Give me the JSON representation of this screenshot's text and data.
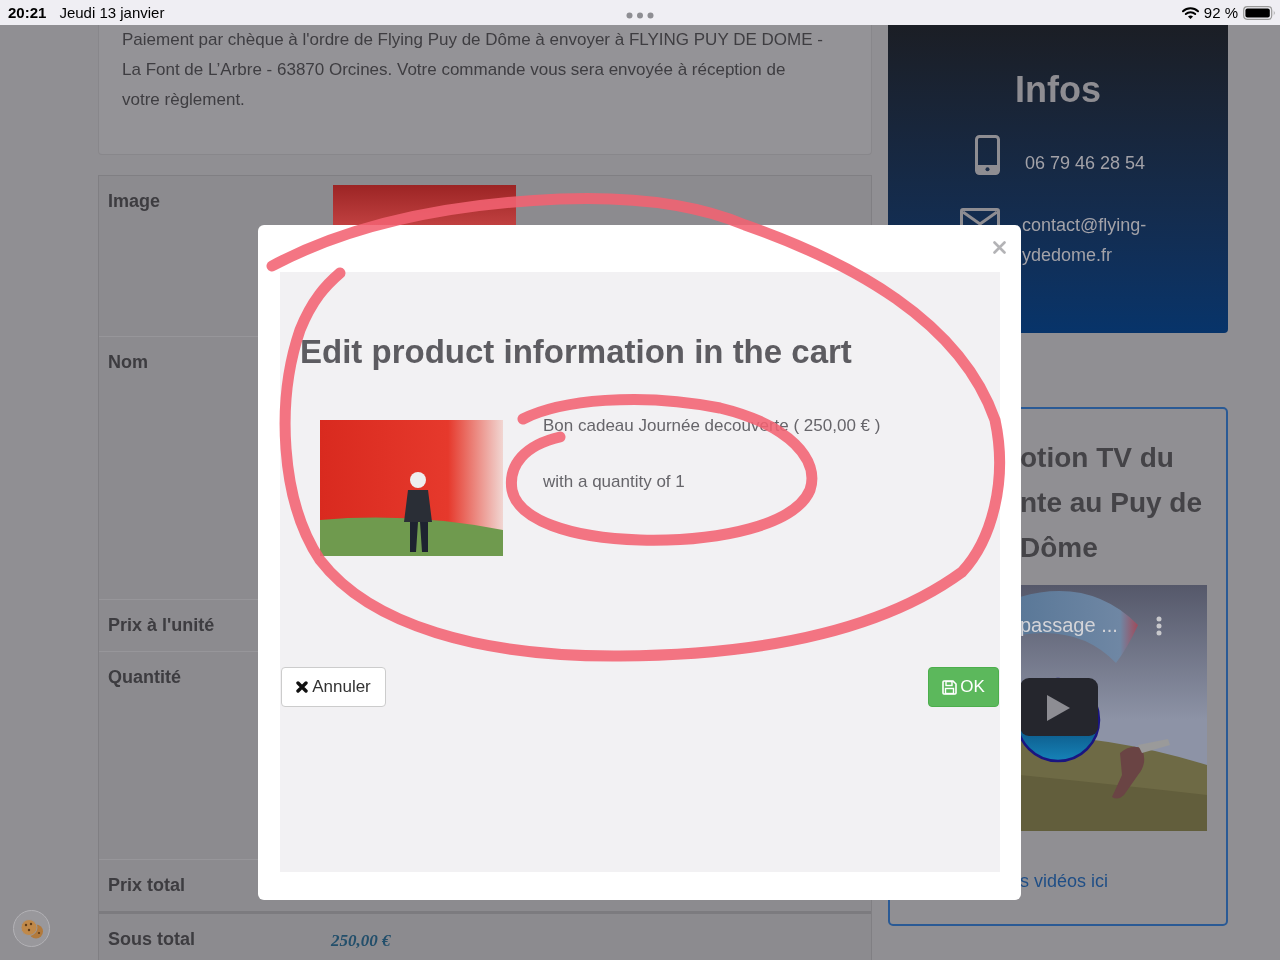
{
  "status_bar": {
    "time": "20:21",
    "date": "Jeudi 13 janvier",
    "battery": "92 %"
  },
  "payment_note": {
    "lines": [
      "Paiement par chèque à l'ordre de Flying Puy de Dôme à envoyer à FLYING PUY DE DOME -",
      "La Font de L’Arbre - 63870 Orcines. Votre commande vous sera envoyée à réception de",
      "votre règlement."
    ]
  },
  "cart_table": {
    "rows": [
      {
        "label": "Image",
        "kind": "image"
      },
      {
        "label": "Nom",
        "kind": "text"
      },
      {
        "label": "Prix à l'unité",
        "kind": "text"
      },
      {
        "label": "Quantité",
        "kind": "text"
      },
      {
        "label": "Prix total",
        "kind": "text"
      },
      {
        "label": "Sous total",
        "kind": "total",
        "value": "250,00 €"
      }
    ]
  },
  "infos": {
    "title": "Infos",
    "phone": "06 79 46 28 54",
    "email_lines": [
      "contact@flying-",
      "ydedome.fr"
    ]
  },
  "video_card": {
    "title_lines": [
      "otion TV du",
      "nte au Puy de",
      "Dôme"
    ],
    "video_title": "passage ...",
    "link": "s vidéos ici"
  },
  "modal": {
    "title": "Edit product information in the cart",
    "product": "Bon cadeau Journée decouverte ( 250,00 € )",
    "quantity": "with a quantity of 1",
    "buttons": [
      {
        "label": "Annuler",
        "kind": "cancel"
      },
      {
        "label": "OK",
        "kind": "save"
      }
    ]
  }
}
